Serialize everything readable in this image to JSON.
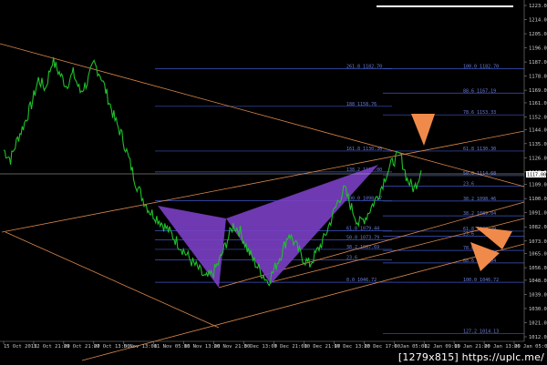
{
  "chart_data": {
    "type": "line",
    "title": "",
    "y_axis_ticks": [
      "1223.00",
      "1214.00",
      "1205.00",
      "1196.00",
      "1187.00",
      "1178.00",
      "1169.00",
      "1161.00",
      "1152.00",
      "1144.00",
      "1135.00",
      "1126.00",
      "1117.00",
      "1109.00",
      "1100.00",
      "1091.00",
      "1082.00",
      "1073.00",
      "1065.00",
      "1056.00",
      "1048.00",
      "1039.00",
      "1030.00",
      "1021.00",
      "1012.00"
    ],
    "x_axis_ticks": [
      "15 Oct 2015",
      "22 Oct 21:00",
      "29 Oct 21:00",
      "27 Oct 13:00",
      "5 Nov 13:00",
      "11 Nov 05:00",
      "16 Nov 13:00",
      "20 Nov 21:00",
      "3 Dec 13:00",
      "7 Dec 21:00",
      "10 Dec 21:00",
      "17 Dec 13:00",
      "23 Dec 17:00",
      "6 Jan 05:00",
      "12 Jan 09:00",
      "15 Jan 21:00",
      "20 Jan 13:00",
      "26 Jan 05:00"
    ],
    "current_price": "1117.00",
    "fib_levels": [
      {
        "label": "261.8 1182.70",
        "price": 1182.7
      },
      {
        "label": "161.8 1130.30",
        "price": 1130.3
      },
      {
        "label": "138.2 1117.00",
        "price": 1117.0
      },
      {
        "label": "100.0 1098.57",
        "price": 1098.57
      },
      {
        "label": "61.8 1079.44",
        "price": 1079.44
      },
      {
        "label": "50.0 1073.79",
        "price": 1073.79
      },
      {
        "label": "38.2 1067.69",
        "price": 1067.69
      },
      {
        "label": "23.6",
        "price": 1061.0
      },
      {
        "label": "0.0 1046.72",
        "price": 1046.72
      },
      {
        "label": "188 1158.76",
        "price": 1158.76
      }
    ],
    "fib_levels_right": [
      {
        "label": "100.0 1182.70",
        "price": 1182.7
      },
      {
        "label": "88.6 1167.19",
        "price": 1167.19
      },
      {
        "label": "78.6 1153.33",
        "price": 1153.33
      },
      {
        "label": "61.8 1130.30",
        "price": 1130.3
      },
      {
        "label": "50.0 1114.68",
        "price": 1114.68
      },
      {
        "label": "38.2 1098.46",
        "price": 1098.46
      },
      {
        "label": "23.6",
        "price": 1108.0
      },
      {
        "label": "38.2 1089.04",
        "price": 1089.04
      },
      {
        "label": "61.8 1079.29",
        "price": 1079.29
      },
      {
        "label": "78.6",
        "price": 1067.0
      },
      {
        "label": "88.6 1059.04",
        "price": 1059.04
      },
      {
        "label": "100.0 1046.72",
        "price": 1046.72
      },
      {
        "label": "127.2 1014.13",
        "price": 1014.13
      },
      {
        "label": "23.6",
        "price": 1076.0
      }
    ],
    "series": [
      {
        "values": [
          1131,
          1125,
          1138,
          1148,
          1160,
          1176,
          1170,
          1188,
          1180,
          1172,
          1180,
          1168,
          1174,
          1186,
          1178,
          1164,
          1150,
          1140,
          1125,
          1110,
          1100,
          1092,
          1088,
          1083,
          1078,
          1072,
          1066,
          1060,
          1055,
          1049,
          1052,
          1060,
          1072,
          1083,
          1079,
          1068,
          1060,
          1053,
          1047,
          1056,
          1066,
          1078,
          1070,
          1062,
          1058,
          1066,
          1074,
          1086,
          1098,
          1106,
          1094,
          1084,
          1088,
          1096,
          1104,
          1116,
          1124,
          1128,
          1112,
          1106,
          1118
        ]
      }
    ],
    "grid": "off",
    "legend": "none"
  },
  "watermark": "[1279x815] https://uplc.me/"
}
